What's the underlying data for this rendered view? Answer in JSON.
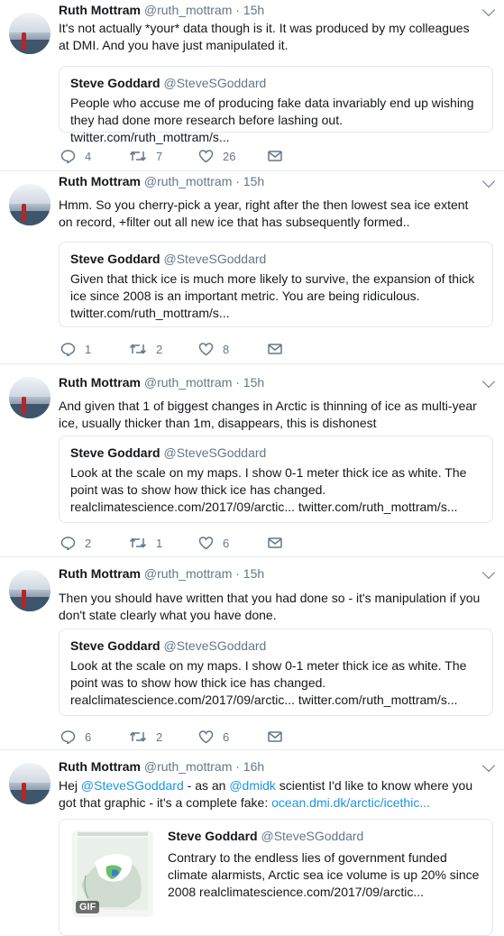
{
  "tweets": [
    {
      "name": "Ruth Mottram",
      "handle": "@ruth_mottram",
      "time": "· 15h",
      "text": "It's not actually *your* data though is it. It was produced by my colleagues at DMI. And you have just manipulated it.",
      "quote": {
        "name": "Steve Goddard",
        "handle": "@SteveSGoddard",
        "text": "People who accuse me of producing fake data invariably end up wishing they had done more research before lashing out. twitter.com/ruth_mottram/s..."
      },
      "replies": "4",
      "retweets": "7",
      "likes": "26"
    },
    {
      "name": "Ruth Mottram",
      "handle": "@ruth_mottram",
      "time": "· 15h",
      "text": "Hmm. So you cherry-pick a year, right after the then lowest sea ice extent on record, +filter out all new ice that has subsequently formed..",
      "quote": {
        "name": "Steve Goddard",
        "handle": "@SteveSGoddard",
        "text": "Given that thick ice is much more likely to survive, the expansion of thick ice since 2008 is an important metric. You are being ridiculous. twitter.com/ruth_mottram/s..."
      },
      "replies": "1",
      "retweets": "2",
      "likes": "8"
    },
    {
      "name": "Ruth Mottram",
      "handle": "@ruth_mottram",
      "time": "· 15h",
      "text": "And given that 1 of biggest changes in Arctic is thinning of ice as multi-year ice, usually thicker than 1m, disappears, this is dishonest",
      "quote": {
        "name": "Steve Goddard",
        "handle": "@SteveSGoddard",
        "text": "Look at the scale on my maps. I show 0-1 meter thick ice as white. The point was to show how thick ice has changed. realclimatescience.com/2017/09/arctic... twitter.com/ruth_mottram/s..."
      },
      "replies": "2",
      "retweets": "1",
      "likes": "6"
    },
    {
      "name": "Ruth Mottram",
      "handle": "@ruth_mottram",
      "time": "· 15h",
      "text": "Then you should have written that you had done so - it's manipulation if you don't state clearly what you have done.",
      "quote": {
        "name": "Steve Goddard",
        "handle": "@SteveSGoddard",
        "text": "Look at the scale on my maps. I show 0-1 meter thick ice as white. The point was to show how thick ice has changed. realclimatescience.com/2017/09/arctic... twitter.com/ruth_mottram/s..."
      },
      "replies": "6",
      "retweets": "2",
      "likes": "6"
    },
    {
      "name": "Ruth Mottram",
      "handle": "@ruth_mottram",
      "time": "· 16h",
      "text_parts": [
        "Hej ",
        "@SteveSGoddard",
        " - as an ",
        "@dmidk",
        " scientist I'd like to know where you got that graphic - it's a complete fake:  ",
        "ocean.dmi.dk/arctic/icethic..."
      ],
      "quote": {
        "name": "Steve Goddard",
        "handle": "@SteveSGoddard",
        "text": "Contrary to the endless lies of government funded climate alarmists, Arctic sea ice volume is up 20% since 2008 realclimatescience.com/2017/09/arctic...",
        "media_badge": "GIF"
      }
    }
  ],
  "colors": {
    "link": "#1b95e0",
    "secondary": "#657786",
    "border": "#e1e8ed"
  },
  "icons": [
    "reply-icon",
    "retweet-icon",
    "like-icon",
    "message-icon",
    "chevron-down-icon"
  ]
}
